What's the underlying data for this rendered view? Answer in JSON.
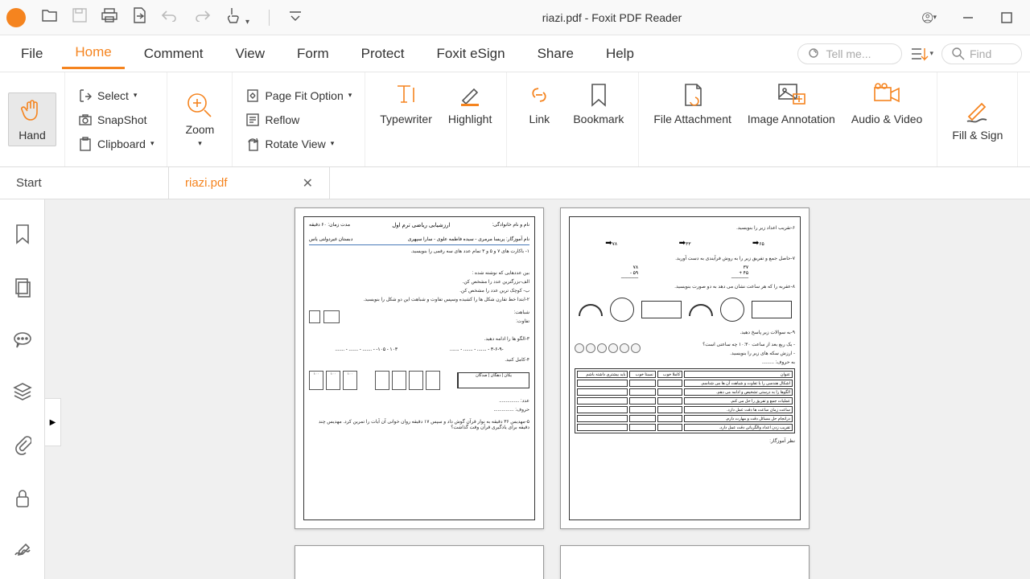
{
  "titlebar": {
    "title": "riazi.pdf - Foxit PDF Reader"
  },
  "menu": {
    "file": "File",
    "home": "Home",
    "comment": "Comment",
    "view": "View",
    "form": "Form",
    "protect": "Protect",
    "esign": "Foxit eSign",
    "share": "Share",
    "help": "Help",
    "tellme": "Tell me...",
    "find": "Find"
  },
  "ribbon": {
    "hand": "Hand",
    "select": "Select",
    "snapshot": "SnapShot",
    "clipboard": "Clipboard",
    "zoom": "Zoom",
    "pagefit": "Page Fit Option",
    "reflow": "Reflow",
    "rotate": "Rotate View",
    "typewriter": "Typewriter",
    "highlight": "Highlight",
    "link": "Link",
    "bookmark": "Bookmark",
    "fileattach": "File Attachment",
    "imageanno": "Image Annotation",
    "audiovideo": "Audio & Video",
    "fillsign": "Fill & Sign"
  },
  "tabs": {
    "start": "Start",
    "doc": "riazi.pdf"
  },
  "doc": {
    "p1": {
      "title": "ارزشیابی ریاضی ترم اول",
      "time": "مدت زمان: ۶۰ دقیقه",
      "name": "نام و نام خانوادگی:",
      "teacher": "نام آموزگار: پریسا مرمری - سیده فاطمه علوی - سارا سپهری",
      "school": "دبستان غیردولتی یاس",
      "q1": "۱- باکارت های ۷  و ۵ و  ۳ تمام عدد های سه رقمی را بنویسید.",
      "q1a": "بین عددهایی که نوشته شده :",
      "q1b": "الف-بزرگترین عدد را مشخص کن.",
      "q1c": "ب- کوچک ترین عدد را مشخص کن.",
      "q2": "۲-ابتدا خط تقارن شکل ها را کشیده وسپس تفاوت و شباهت این دو شکل را بنویسید.",
      "sim": "شباهت:",
      "diff": "تفاوت:",
      "q3": "۳-الگو ها را ادامه دهید.",
      "math1": "۳-۶-۹-",
      "math2": "-۱۰۵ - ۱۰۳",
      "q4": "۴-کامل کنید.",
      "units": "یکان | دهگان | صدگان",
      "num": "عدد:",
      "letters": "حروف:",
      "q5": "۵-مهدیس ۳۶ دقیقه به نوار قرآن گوش داد و سپس ۱۷ دقیقه روان خوانی آن آیات را تمرین کرد. مهدیس چند دقیقه برای یادگیری قرآن وقت گذاشت؟"
    },
    "p2": {
      "q6": "۶-تقریب اعداد زیر را بنویسید.",
      "n1": "۷۸",
      "n2": "۳۳",
      "n3": "۶۵",
      "q7": "۷-حاصل جمع و تفریق زیر را به روش فرآیندی به دست آورید.",
      "a1": "۳۷",
      "a2": "۴۵",
      "a3": "۷۸",
      "a4": "۵۹",
      "q8": "۸-عقربه را که هر ساعت نشان می دهد به دو صورت بنویسید.",
      "q9": "۹-به سوالات زیر پاسخ دهید.",
      "q9a": "- یک ربع بعد از ساعت ۱۰:۳۰ چه ساعتی است؟",
      "q9b": "- ارزش سکه های زیر را بنویسید.",
      "letters2": "به حروف:",
      "thead": [
        "عنوان",
        "کاملا خوب",
        "نسبتا خوب",
        "باید بیشتری داشته باشم"
      ],
      "trows": [
        "اشکال هندسی را با تفاوت و شباهت آن ها می شناسم.",
        "الگوها را به درستی تشخیص و ادامه می دهم.",
        "عملیات جمع و تفریق را حل می کنم.",
        "ساعت زمان ساعت ها دقت عمل دارد.",
        "درانجام حل مسائل دقت و مهارت دارم.",
        "تقریب زدن اعداد والگریاتی دقت عمل دارد."
      ],
      "footer": "نظر آموزگار:"
    }
  }
}
